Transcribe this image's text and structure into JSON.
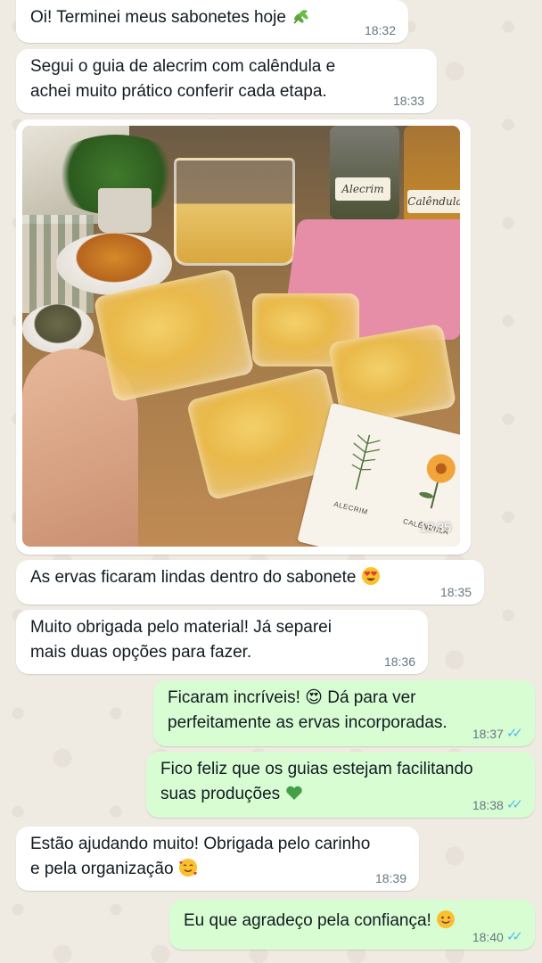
{
  "chat": {
    "messages": [
      {
        "direction": "in",
        "text": "Oi! Terminei meus sabonetes hoje",
        "time": "18:32"
      },
      {
        "direction": "in",
        "text_line1": "Segui o guia de alecrim com calêndula e",
        "text_line2": "achei muito prático conferir cada etapa.",
        "time": "18:33"
      },
      {
        "direction": "in",
        "type": "image",
        "time": "18:35",
        "image_labels": {
          "jar_left": "Alecrim",
          "jar_right": "Calêndula",
          "card_left": "ALECRIM",
          "card_right": "CALÊNDULA"
        }
      },
      {
        "direction": "in",
        "text": "As ervas ficaram lindas dentro do sabonete",
        "time": "18:35"
      },
      {
        "direction": "in",
        "text_line1": "Muito obrigada pelo material! Já separei",
        "text_line2": "mais duas opções para fazer.",
        "time": "18:36"
      },
      {
        "direction": "out",
        "text_line1": "Ficaram incríveis! 😍 Dá para ver",
        "text_line2": "perfeitamente as ervas incorporadas.",
        "time": "18:37"
      },
      {
        "direction": "out",
        "text_line1": "Fico feliz que os guias estejam facilitando",
        "text_line2": "suas produções",
        "time": "18:38"
      },
      {
        "direction": "in",
        "text_line1": "Estão ajudando muito! Obrigada pelo carinho",
        "text_line2": "e pela organização",
        "time": "18:39"
      },
      {
        "direction": "out",
        "text": "Eu que agradeço pela confiança!",
        "time": "18:40"
      }
    ]
  },
  "colors": {
    "background": "#efeae2",
    "incoming_bubble": "#ffffff",
    "outgoing_bubble": "#d9fdd3",
    "read_ticks": "#53bdeb",
    "timestamp": "#667781"
  },
  "icons": [
    "herb-emoji",
    "heart-eyes-emoji",
    "green-heart-emoji",
    "smiling-hearts-emoji",
    "smile-emoji",
    "double-check-icon"
  ]
}
